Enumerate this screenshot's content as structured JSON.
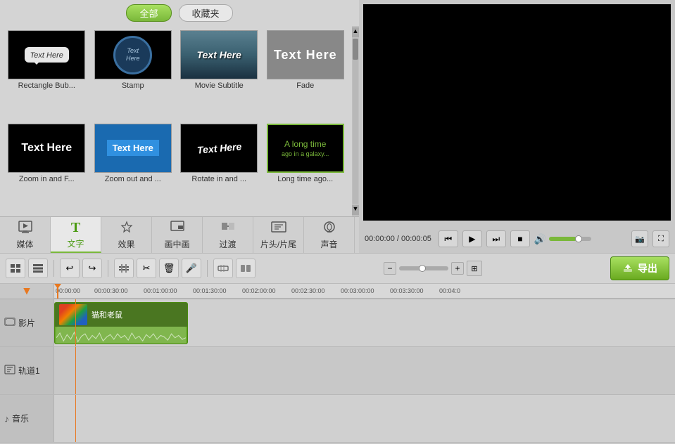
{
  "filter": {
    "all_label": "全部",
    "favorites_label": "收藏夹"
  },
  "thumbnails": [
    {
      "id": "rect-bubble",
      "label": "Rectangle Bub...",
      "style": "rect-bubble",
      "text": "Text Here"
    },
    {
      "id": "stamp",
      "label": "Stamp",
      "style": "stamp",
      "text": "Text Here"
    },
    {
      "id": "movie-subtitle",
      "label": "Movie Subtitle",
      "style": "movie",
      "text": "Text Here"
    },
    {
      "id": "fade",
      "label": "Fade",
      "style": "fade",
      "text": "Text Here"
    },
    {
      "id": "zoom-in",
      "label": "Zoom in and F...",
      "style": "zoom-in",
      "text": "Text Here"
    },
    {
      "id": "zoom-out",
      "label": "Zoom out and ...",
      "style": "zoom-out",
      "text": "Text Here"
    },
    {
      "id": "rotate-in",
      "label": "Rotate in and ...",
      "style": "rotate-in",
      "text": "Text Here"
    },
    {
      "id": "long-time",
      "label": "Long time ago...",
      "style": "long-time",
      "text": "A long time"
    }
  ],
  "tabs": [
    {
      "id": "media",
      "label": "媒体",
      "icon": "🎬"
    },
    {
      "id": "text",
      "label": "文字",
      "icon": "T",
      "active": true
    },
    {
      "id": "effects",
      "label": "效果",
      "icon": "✨"
    },
    {
      "id": "picture-in-picture",
      "label": "画中画",
      "icon": "🎞"
    },
    {
      "id": "transition",
      "label": "过渡",
      "icon": "⬜"
    },
    {
      "id": "credits",
      "label": "片头/片尾",
      "icon": "🎬"
    },
    {
      "id": "audio",
      "label": "声音",
      "icon": "🎧"
    }
  ],
  "video": {
    "time_current": "00:00:00",
    "time_total": "00:00:05",
    "time_display": "00:00:00 / 00:00:05"
  },
  "toolbar": {
    "undo_label": "↩",
    "redo_label": "↪",
    "cut_label": "✂",
    "delete_label": "🗑",
    "record_label": "🎤",
    "detach_label": "📎",
    "export_label": "导出",
    "export_icon": "📤"
  },
  "timeline": {
    "tracks": [
      {
        "id": "film",
        "label": "影片",
        "icon": "🎬"
      },
      {
        "id": "track1",
        "label": "轨道1",
        "icon": "📝"
      },
      {
        "id": "music",
        "label": "音乐",
        "icon": "♪"
      }
    ],
    "clip": {
      "name": "猫和老鼠",
      "start": "00:00:00:00"
    },
    "ruler_marks": [
      "00:00:00",
      "00:00:30:00",
      "00:01:00:00",
      "00:01:30:00",
      "00:02:00:00",
      "00:02:30:00",
      "00:03:00:00",
      "00:03:30:00",
      "00:04:0"
    ]
  }
}
